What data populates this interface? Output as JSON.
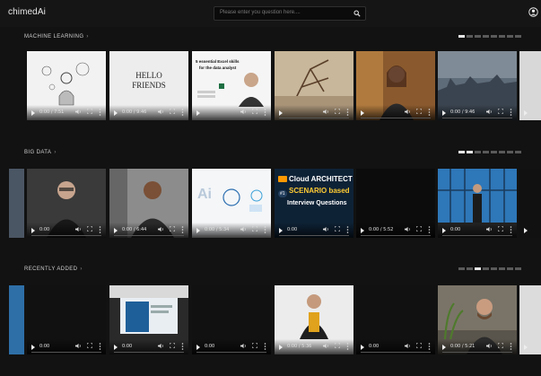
{
  "app": {
    "logo": "chimedAi"
  },
  "search": {
    "placeholder": "Please enter you question here...."
  },
  "sections": [
    {
      "title": "MACHINE LEARNING",
      "chevron": "›",
      "pager_active": 0,
      "pager_count": 8,
      "times": [
        "0:00 / 7:51",
        "0:00 / 9:46",
        "",
        "",
        "",
        "0:00 / 9:46"
      ]
    },
    {
      "title": "BIG DATA",
      "chevron": "›",
      "pager_active": 0,
      "pager_count": 8,
      "times": [
        "0:00",
        "0:00 / 6:44",
        "0:00 / 5:34",
        "0:00",
        "0:00 / 5:52",
        "0:00"
      ],
      "thumb_texts": {
        "ai_logo": "Ai",
        "cloud_badge": "#1",
        "cloud_line1": "Cloud ARCHITECT",
        "cloud_line2": "SCENARIO based",
        "cloud_line3": "Interview Questions"
      }
    },
    {
      "title": "RECENTLY ADDED",
      "chevron": "›",
      "pager_active": 2,
      "pager_count": 8,
      "times": [
        "0:00",
        "0:00",
        "0:00",
        "0:00 / 5:36",
        "0:00",
        "0:00 / 5:21"
      ]
    }
  ],
  "thumb_texts": {
    "hello_1": "HELLO",
    "hello_2": "FRIENDS",
    "excel_1": "5 essential Excel skills",
    "excel_2": "for the data analyst"
  },
  "icons": {
    "search": "search-icon",
    "account": "account-icon",
    "play": "play-icon",
    "volume": "volume-icon",
    "fullscreen": "fullscreen-icon",
    "more": "more-icon"
  }
}
